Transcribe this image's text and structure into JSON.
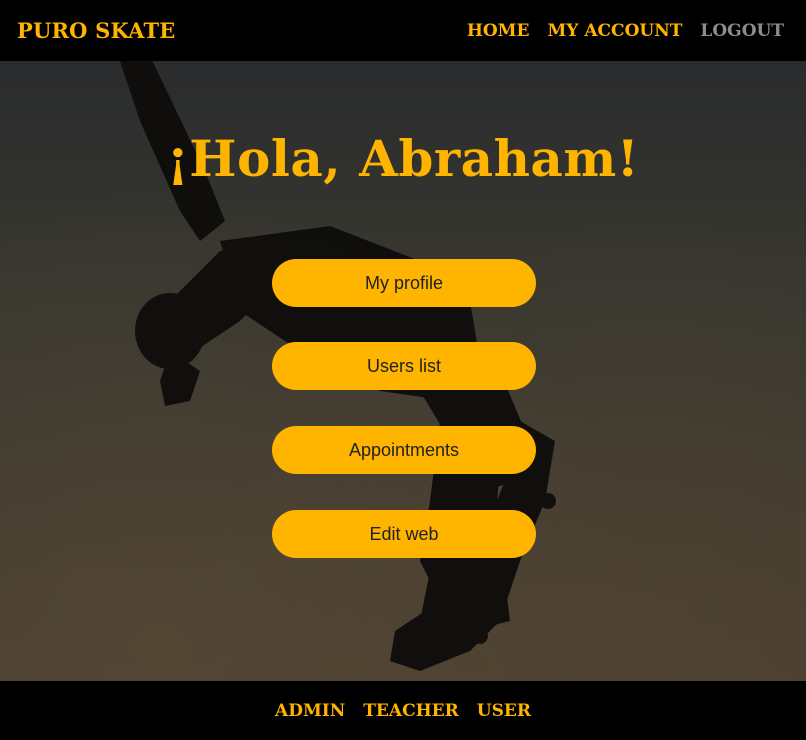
{
  "navbar": {
    "brand": "PURO SKATE",
    "links": [
      {
        "label": "HOME"
      },
      {
        "label": "MY ACCOUNT"
      },
      {
        "label": "LOGOUT"
      }
    ]
  },
  "hero": {
    "greeting": "¡Hola, Abraham!",
    "buttons": [
      {
        "label": "My profile"
      },
      {
        "label": "Users list"
      },
      {
        "label": "Appointments"
      },
      {
        "label": "Edit web"
      }
    ]
  },
  "footer": {
    "links": [
      {
        "label": "ADMIN"
      },
      {
        "label": "TEACHER"
      },
      {
        "label": "USER"
      }
    ]
  },
  "colors": {
    "accent": "#ffb400",
    "muted_link": "#8d8d8d",
    "bar_background": "#000000"
  }
}
